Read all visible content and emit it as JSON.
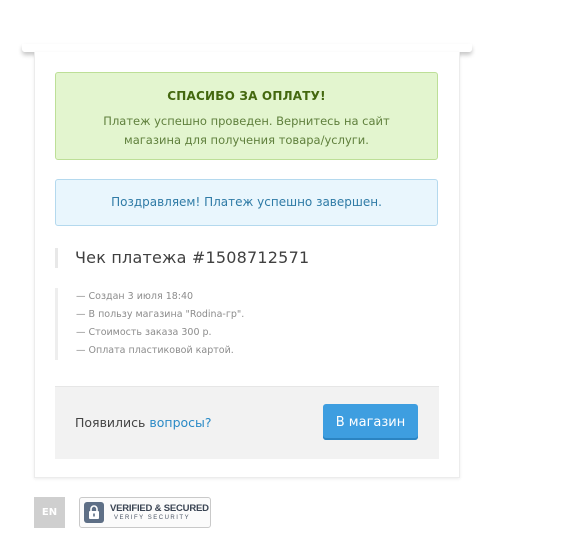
{
  "success_alert": {
    "title": "СПАСИБО ЗА ОПЛАТУ!",
    "line1": "Платеж успешно проведен. Вернитесь на сайт",
    "line2": "магазина для получения товара/услуги."
  },
  "info_alert": {
    "text": "Поздравляем! Платеж успешно завершен."
  },
  "receipt": {
    "title": "Чек платежа #1508712571",
    "details": [
      "Создан 3 июля 18:40",
      "В пользу магазина \"Rodina-гр\".",
      "Стоимость заказа 300 р.",
      "Оплата пластиковой картой."
    ]
  },
  "footer": {
    "question_prefix": "Появились ",
    "question_link": "вопросы?",
    "shop_button": "В магазин"
  },
  "language": "EN",
  "security_badge": {
    "line1": "VERIFIED & SECURED",
    "line2": "VERIFY SECURITY",
    "icon": "lock-icon"
  },
  "colors": {
    "success_bg": "#e3f5cf",
    "info_bg": "#e9f6fd",
    "button_bg": "#3e9ee0",
    "link": "#2a8ac6"
  }
}
